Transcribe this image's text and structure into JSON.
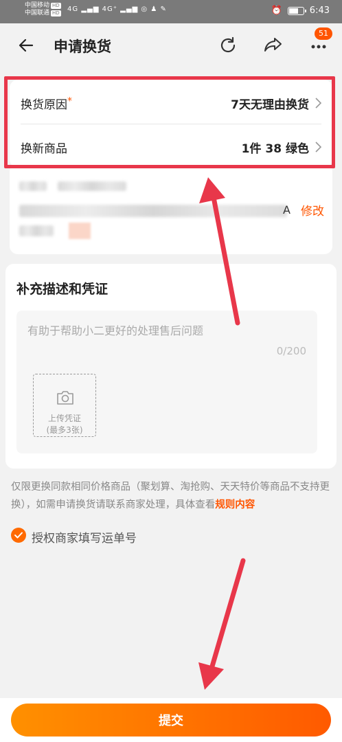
{
  "status_bar": {
    "carrier1": "中国移动",
    "carrier2": "中国联通",
    "hd": "HD",
    "signal1": "4G",
    "signal2": "4G⁺",
    "time": "6:43",
    "battery_level": 0.7
  },
  "header": {
    "title": "申请换货",
    "badge_count": "51"
  },
  "exchange": {
    "reason_label": "换货原因",
    "required_mark": "*",
    "reason_value": "7天无理由换货",
    "product_label": "换新商品",
    "product_value": "1件 38 绿色"
  },
  "address": {
    "partial_text": "A",
    "edit_label": "修改"
  },
  "evidence": {
    "section_title": "补充描述和凭证",
    "placeholder": "有助于帮助小二更好的处理售后问题",
    "counter": "0/200",
    "upload_label": "上传凭证",
    "upload_limit": "(最多3张)"
  },
  "notice": {
    "text": "仅限更换同款相同价格商品（聚划算、淘抢购、天天特价等商品不支持更换），如需申请换货请联系商家处理，具体查看",
    "link": "规则内容"
  },
  "authorize": {
    "label": "授权商家填写运单号",
    "checked": true
  },
  "footer": {
    "submit_label": "提交"
  },
  "colors": {
    "accent": "#ff5500",
    "annotation": "#e8374a"
  },
  "icons": [
    "back-arrow-icon",
    "refresh-icon",
    "share-icon",
    "more-icon",
    "chevron-right-icon",
    "camera-icon",
    "check-icon"
  ]
}
